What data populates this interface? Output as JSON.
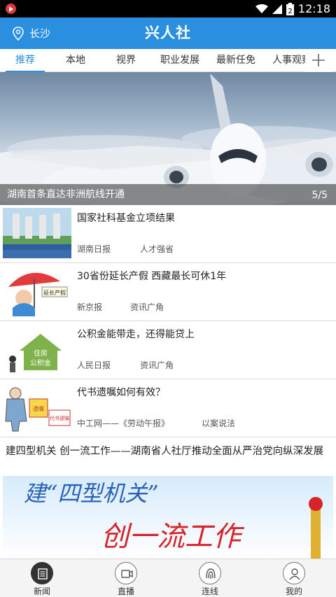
{
  "status_bar": {
    "time": "12:18",
    "battery": "2",
    "icons": [
      "record-icon",
      "wifi-icon",
      "signal-icon",
      "battery-icon"
    ]
  },
  "header": {
    "location": "长沙",
    "title": "兴人社",
    "accent": "#2b8fe0"
  },
  "tabs": {
    "items": [
      {
        "label": "推荐",
        "active": true
      },
      {
        "label": "本地"
      },
      {
        "label": "视界"
      },
      {
        "label": "职业发展"
      },
      {
        "label": "最新任免"
      },
      {
        "label": "人事观察"
      }
    ],
    "add_icon": "plus-icon"
  },
  "banner": {
    "caption": "湖南首条直达非洲航线开通",
    "pager": "5/5"
  },
  "news": [
    {
      "title": "国家社科基金立项结果",
      "source": "湖南日报",
      "category": "人才强省"
    },
    {
      "title": "30省份延长产假 西藏最长可休1年",
      "source": "新京报",
      "category": "资讯广角",
      "image_text": "延长产假"
    },
    {
      "title": "公积金能带走，还得能贷上",
      "source": "人民日报",
      "category": "资讯广角",
      "image_text_1": "住房",
      "image_text_2": "公积金"
    },
    {
      "title": "代书遗嘱如何有效？",
      "source": "中工网——《劳动午报》",
      "category": "以案说法",
      "image_text_1": "遗嘱",
      "image_text_2": "代书遗嘱"
    }
  ],
  "feature": {
    "title": "建四型机关 创一流工作——湖南省人社厅推动全面从严治党向纵深发展",
    "image_line1": "建“四型机关”",
    "image_line2": "创一流工作"
  },
  "bottom_nav": [
    {
      "label": "新闻",
      "icon": "news-icon",
      "active": true
    },
    {
      "label": "直播",
      "icon": "live-icon"
    },
    {
      "label": "连线",
      "icon": "connect-icon"
    },
    {
      "label": "我的",
      "icon": "profile-icon"
    }
  ]
}
